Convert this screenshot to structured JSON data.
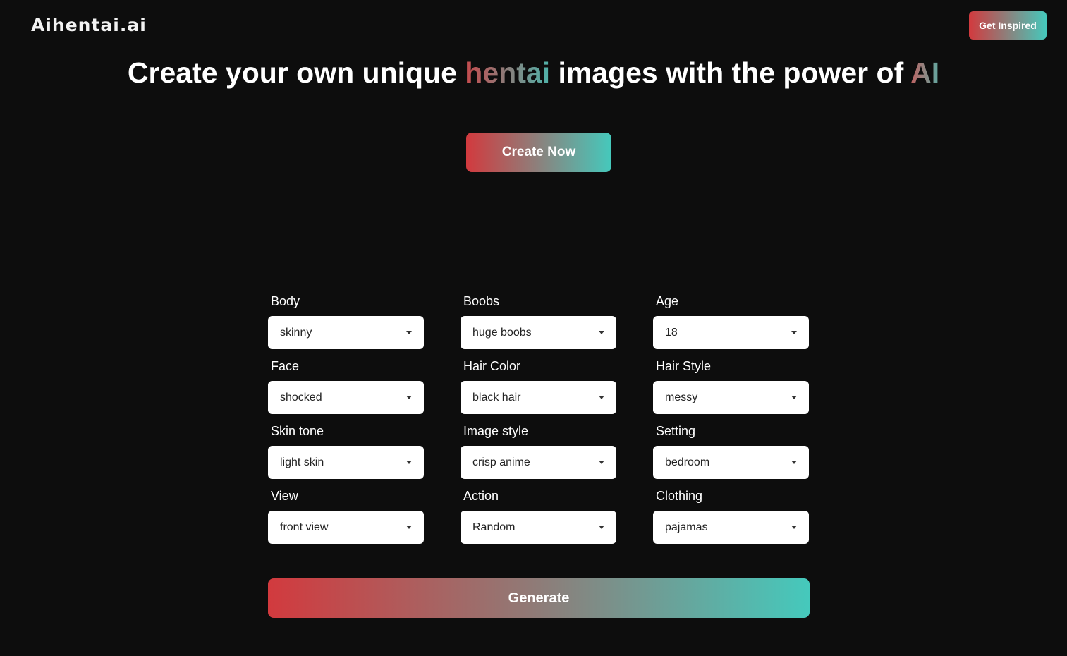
{
  "header": {
    "logo_text": "Aihentai.ai",
    "inspire_label": "Get Inspired"
  },
  "hero": {
    "title_part1": "Create your own unique ",
    "title_highlight1": "hentai",
    "title_part2": " images with the power of ",
    "title_highlight2": "AI",
    "create_label": "Create Now"
  },
  "form": {
    "fields": [
      {
        "label": "Body",
        "value": "skinny"
      },
      {
        "label": "Boobs",
        "value": "huge boobs"
      },
      {
        "label": "Age",
        "value": "18"
      },
      {
        "label": "Face",
        "value": "shocked"
      },
      {
        "label": "Hair Color",
        "value": "black hair"
      },
      {
        "label": "Hair Style",
        "value": "messy"
      },
      {
        "label": "Skin tone",
        "value": "light skin"
      },
      {
        "label": "Image style",
        "value": "crisp anime"
      },
      {
        "label": "Setting",
        "value": "bedroom"
      },
      {
        "label": "View",
        "value": "front view"
      },
      {
        "label": "Action",
        "value": "Random"
      },
      {
        "label": "Clothing",
        "value": "pajamas"
      }
    ],
    "generate_label": "Generate"
  },
  "colors": {
    "background": "#0d0d0d",
    "gradient_start": "#d23a3e",
    "gradient_end": "#45c9bc",
    "select_bg": "#ffffff"
  },
  "icons": {
    "select_caret": "caret-down-icon"
  }
}
